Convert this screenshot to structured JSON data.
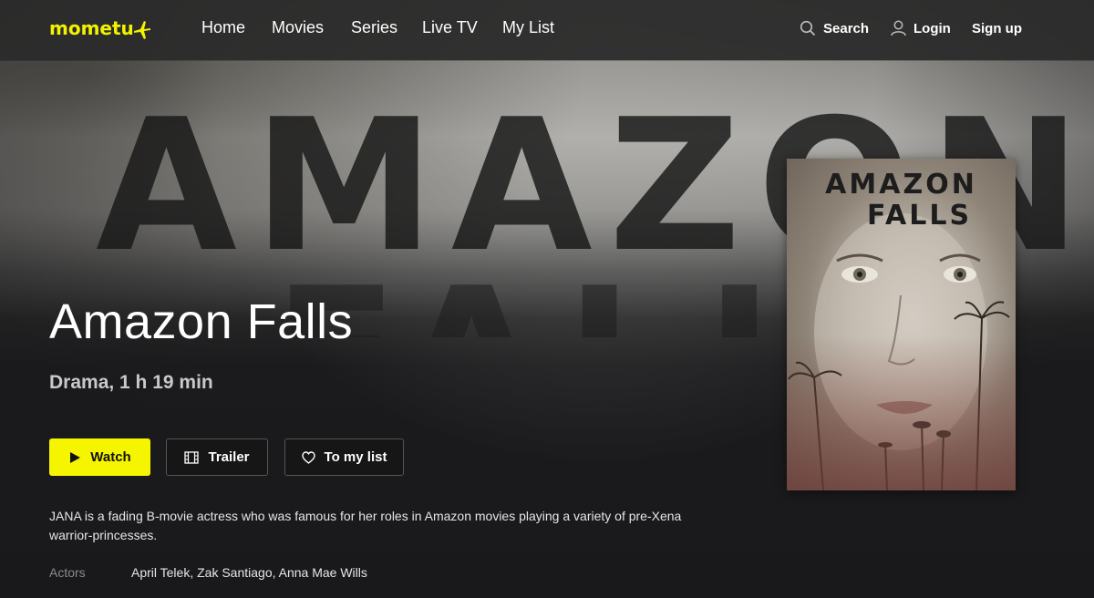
{
  "nav": {
    "logo": "mometu",
    "links": [
      "Home",
      "Movies",
      "Series",
      "Live TV",
      "My List"
    ],
    "search_label": "Search",
    "login_label": "Login",
    "signup_label": "Sign up"
  },
  "hero": {
    "background_word": "AMAZON",
    "background_word2": "FALLS"
  },
  "movie": {
    "title": "Amazon Falls",
    "meta": "Drama, 1 h 19 min",
    "description": "JANA is a fading B-movie actress who was famous for her roles in Amazon movies playing a variety of pre-Xena warrior-princesses.",
    "actors_label": "Actors",
    "actors": "April Telek, Zak Santiago, Anna Mae Wills"
  },
  "buttons": {
    "watch": "Watch",
    "trailer": "Trailer",
    "my_list": "To my list"
  },
  "poster": {
    "line1": "AMAZON",
    "line2": "FALLS"
  },
  "colors": {
    "accent": "#f5f500",
    "logo": "#f2f200",
    "background": "#19191b"
  }
}
